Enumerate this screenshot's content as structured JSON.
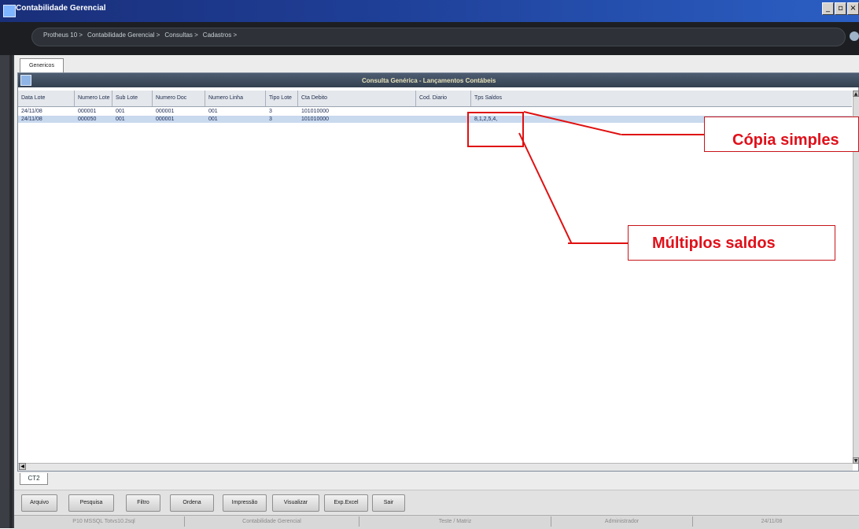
{
  "window": {
    "title": "Contabilidade Gerencial",
    "min_glyph": "_",
    "restore_glyph": "▫",
    "close_glyph": "×"
  },
  "breadcrumbs": [
    {
      "label": "Protheus 10 >"
    },
    {
      "label": "Contabilidade Gerencial >"
    },
    {
      "label": "Consultas >"
    },
    {
      "label": "Cadastros >"
    }
  ],
  "tabs": {
    "top": "Genericos",
    "bottom": "CT2"
  },
  "panel": {
    "title": "Consulta Genérica - Lançamentos Contábeis"
  },
  "grid": {
    "columns": [
      "Data Lote",
      "Numero Lote",
      "Sub Lote",
      "Numero Doc",
      "Numero Linha",
      "Tipo Lote",
      "Cta Debito",
      "Cod. Diario",
      "Tps Saldos"
    ],
    "rows": [
      [
        "24/11/08",
        "000001",
        "001",
        "000001",
        "001",
        "3",
        "101010000",
        "",
        ""
      ],
      [
        "24/11/08",
        "000050",
        "001",
        "000001",
        "001",
        "3",
        "101010000",
        "",
        "8,1,2,5,4,"
      ]
    ]
  },
  "toolbar": [
    "Arquivo",
    "Pesquisa",
    "Filtro",
    "Ordena",
    "Impressão",
    "Visualizar",
    "Exp.Excel",
    "Sair"
  ],
  "status": [
    "P10 MSSQL Totvs10.2sql",
    "Contabilidade Gerencial",
    "Teste / Matriz",
    "Administrador",
    "24/11/08"
  ],
  "annotations": {
    "simple_copy": "Cópia simples",
    "multiple_balances": "Múltiplos saldos"
  },
  "colors": {
    "title_bar": "#1e3d94",
    "annotation_red": "#e01010",
    "selected_row": "#c9d9ee"
  }
}
